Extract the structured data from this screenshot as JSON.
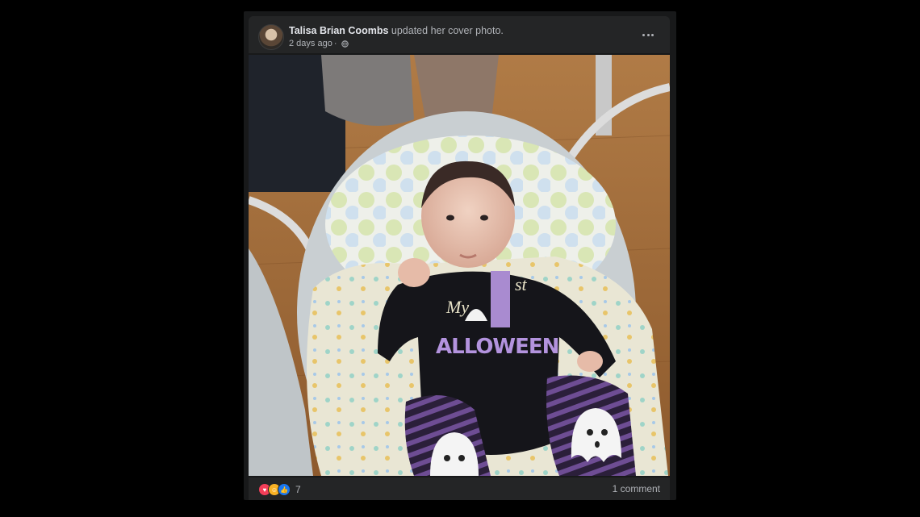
{
  "post": {
    "author": "Talisa Brian Coombs",
    "action": "updated her cover photo.",
    "time": "2 days ago",
    "time_separator": "·",
    "privacy_icon": "globe-icon",
    "menu_icon": "more-horizontal-icon"
  },
  "reactions": {
    "icons": [
      "love-reaction-icon",
      "haha-reaction-icon",
      "like-reaction-icon"
    ],
    "count": "7"
  },
  "comments": {
    "label": "1 comment"
  },
  "colors": {
    "card_bg": "#242526",
    "text_primary": "#e4e6eb",
    "text_secondary": "#b0b3b8",
    "love": "#f33e58",
    "haha": "#f7b125",
    "like": "#1877f2"
  }
}
